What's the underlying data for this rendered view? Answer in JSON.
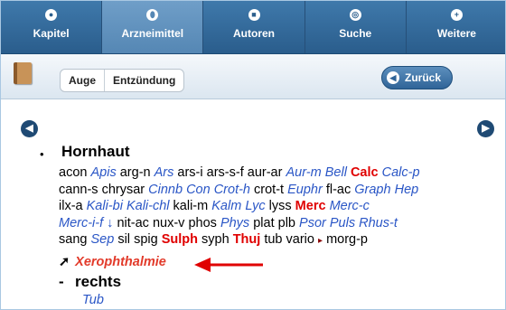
{
  "tabs": [
    {
      "label": "Kapitel",
      "icon": "book-icon",
      "glyph": "●",
      "active": false
    },
    {
      "label": "Arzneimittel",
      "icon": "pill-icon",
      "glyph": "⬮",
      "active": true
    },
    {
      "label": "Autoren",
      "icon": "person-icon",
      "glyph": "■",
      "active": false
    },
    {
      "label": "Suche",
      "icon": "search-icon",
      "glyph": "◎",
      "active": false
    },
    {
      "label": "Weitere",
      "icon": "plus-icon",
      "glyph": "+",
      "active": false
    }
  ],
  "toolbar": {
    "breadcrumbs": [
      "Auge",
      "Entzündung"
    ],
    "back_label": "Zurück"
  },
  "content": {
    "heading": "Hornhaut",
    "remedy_lines": [
      [
        {
          "t": "acon",
          "s": "plain"
        },
        {
          "t": "Apis",
          "s": "blue"
        },
        {
          "t": "arg-n",
          "s": "plain"
        },
        {
          "t": "Ars",
          "s": "blue"
        },
        {
          "t": "ars-i",
          "s": "plain"
        },
        {
          "t": "ars-s-f",
          "s": "plain"
        },
        {
          "t": "aur-ar",
          "s": "plain"
        },
        {
          "t": "Aur-m",
          "s": "blue"
        },
        {
          "t": "Bell",
          "s": "blue"
        },
        {
          "t": "Calc",
          "s": "red"
        },
        {
          "t": "Calc-p",
          "s": "blue"
        }
      ],
      [
        {
          "t": "cann-s",
          "s": "plain"
        },
        {
          "t": "chrysar",
          "s": "plain"
        },
        {
          "t": "Cinnb",
          "s": "blue"
        },
        {
          "t": "Con",
          "s": "blue"
        },
        {
          "t": "Crot-h",
          "s": "blue"
        },
        {
          "t": "crot-t",
          "s": "plain"
        },
        {
          "t": "Euphr",
          "s": "blue"
        },
        {
          "t": "fl-ac",
          "s": "plain"
        },
        {
          "t": "Graph",
          "s": "blue"
        },
        {
          "t": "Hep",
          "s": "blue"
        }
      ],
      [
        {
          "t": "ilx-a",
          "s": "plain"
        },
        {
          "t": "Kali-bi",
          "s": "blue"
        },
        {
          "t": "Kali-chl",
          "s": "blue"
        },
        {
          "t": "kali-m",
          "s": "plain"
        },
        {
          "t": "Kalm",
          "s": "blue"
        },
        {
          "t": "Lyc",
          "s": "blue"
        },
        {
          "t": "lyss",
          "s": "plain"
        },
        {
          "t": "Merc",
          "s": "red"
        },
        {
          "t": "Merc-c",
          "s": "blue"
        }
      ],
      [
        {
          "t": "Merc-i-f ↓",
          "s": "blue"
        },
        {
          "t": "nit-ac",
          "s": "plain"
        },
        {
          "t": "nux-v",
          "s": "plain"
        },
        {
          "t": "phos",
          "s": "plain"
        },
        {
          "t": "Phys",
          "s": "blue"
        },
        {
          "t": "plat",
          "s": "plain"
        },
        {
          "t": "plb",
          "s": "plain"
        },
        {
          "t": "Psor",
          "s": "blue"
        },
        {
          "t": "Puls",
          "s": "blue"
        },
        {
          "t": "Rhus-t",
          "s": "blue"
        }
      ],
      [
        {
          "t": "sang",
          "s": "plain"
        },
        {
          "t": "Sep",
          "s": "blue"
        },
        {
          "t": "sil",
          "s": "plain"
        },
        {
          "t": "spig",
          "s": "plain"
        },
        {
          "t": "Sulph",
          "s": "red"
        },
        {
          "t": "syph",
          "s": "plain"
        },
        {
          "t": "Thuj",
          "s": "red"
        },
        {
          "t": "tub",
          "s": "plain"
        },
        {
          "t": "vario",
          "s": "plain"
        },
        {
          "t": "▸",
          "s": "tri"
        },
        {
          "t": "morg-p",
          "s": "plain"
        }
      ]
    ],
    "crossref_label": "Xerophthalmie",
    "subrubric": {
      "dash": "-",
      "title": "rechts",
      "remedy": "Tub"
    }
  },
  "colors": {
    "tabbar": "#2f6395",
    "remedy_blue": "#2a56c6",
    "remedy_red": "#e00000",
    "annotation_arrow": "#e00000"
  }
}
